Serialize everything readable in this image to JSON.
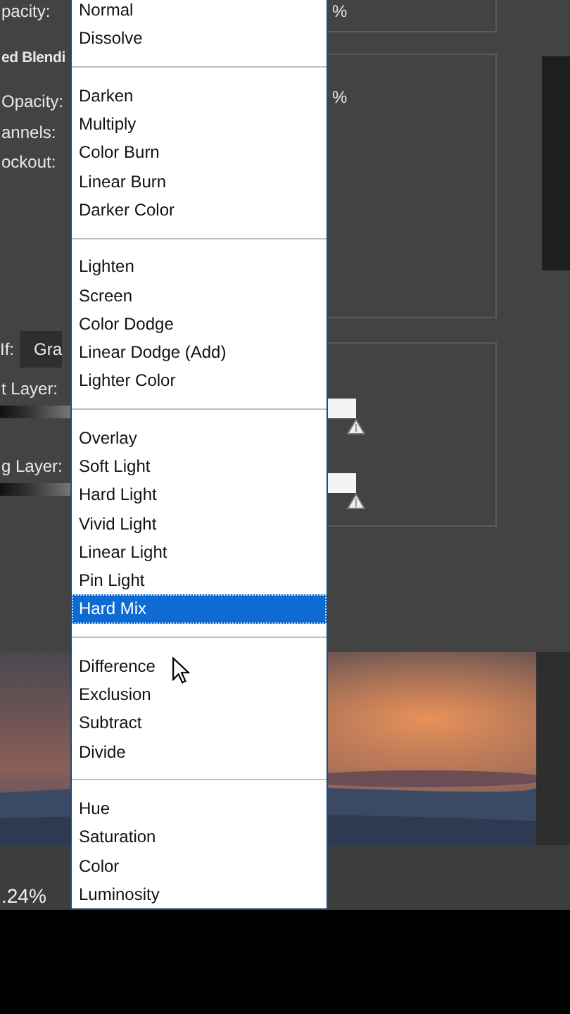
{
  "dialog": {
    "labels": [
      "pacity:",
      "ed Blendi",
      "Opacity:",
      "annels:",
      "ockout:"
    ],
    "percent_signs": [
      "%",
      "%"
    ],
    "blend_if": {
      "label": "If:",
      "value": "Gra"
    },
    "this_layer": {
      "label": "t Layer:"
    },
    "underlying_layer": {
      "label": "g Layer:"
    }
  },
  "menu": {
    "groups": [
      {
        "items": [
          {
            "label": "Normal",
            "selected": false
          },
          {
            "label": "Dissolve",
            "selected": false
          }
        ]
      },
      {
        "items": [
          {
            "label": "Darken",
            "selected": false
          },
          {
            "label": "Multiply",
            "selected": false
          },
          {
            "label": "Color Burn",
            "selected": false
          },
          {
            "label": "Linear Burn",
            "selected": false
          },
          {
            "label": "Darker Color",
            "selected": false
          }
        ]
      },
      {
        "items": [
          {
            "label": "Lighten",
            "selected": false
          },
          {
            "label": "Screen",
            "selected": false
          },
          {
            "label": "Color Dodge",
            "selected": false
          },
          {
            "label": "Linear Dodge (Add)",
            "selected": false
          },
          {
            "label": "Lighter Color",
            "selected": false
          }
        ]
      },
      {
        "items": [
          {
            "label": "Overlay",
            "selected": false
          },
          {
            "label": "Soft Light",
            "selected": false
          },
          {
            "label": "Hard Light",
            "selected": false
          },
          {
            "label": "Vivid Light",
            "selected": false
          },
          {
            "label": "Linear Light",
            "selected": false
          },
          {
            "label": "Pin Light",
            "selected": false
          },
          {
            "label": "Hard Mix",
            "selected": true
          }
        ]
      },
      {
        "items": [
          {
            "label": "Difference",
            "selected": false
          },
          {
            "label": "Exclusion",
            "selected": false
          },
          {
            "label": "Subtract",
            "selected": false
          },
          {
            "label": "Divide",
            "selected": false
          }
        ]
      },
      {
        "items": [
          {
            "label": "Hue",
            "selected": false
          },
          {
            "label": "Saturation",
            "selected": false
          },
          {
            "label": "Color",
            "selected": false
          },
          {
            "label": "Luminosity",
            "selected": false
          }
        ]
      }
    ]
  },
  "status_bar": {
    "zoom": ".24%"
  }
}
